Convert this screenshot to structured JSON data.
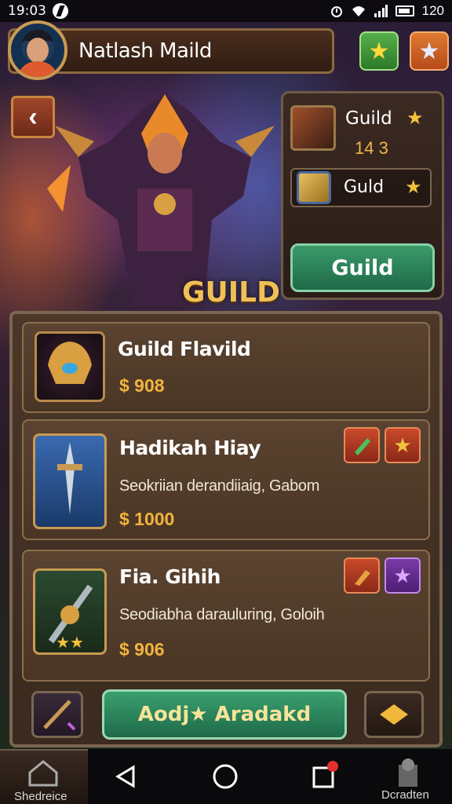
{
  "status_bar": {
    "time": "19:03",
    "battery": "120"
  },
  "header": {
    "player_name": "Natlash Maild"
  },
  "guild_title": "GUILD",
  "info_panel": {
    "item1_label": "Guild",
    "item1_value": "14 3",
    "item2_label": "Guld",
    "button_label": "Guild"
  },
  "items": [
    {
      "title": "Guild Flavild",
      "price": "$ 908"
    },
    {
      "title": "Hadikah Hiay",
      "desc": "Seokriian derandiiaig, Gabom",
      "price": "$ 1000"
    },
    {
      "title": "Fia. Gihih",
      "desc": "Seodiabha darauluring, Goloih",
      "price": "$ 906"
    }
  ],
  "bottom": {
    "action_label": "Aodj★ Aradakd"
  },
  "nav": {
    "left_label": "Shedreice",
    "right_label": "Dcradten"
  },
  "colors": {
    "accent_gold": "#f0c056",
    "button_green": "#2f8a5e",
    "panel_brown": "#4a3728"
  }
}
